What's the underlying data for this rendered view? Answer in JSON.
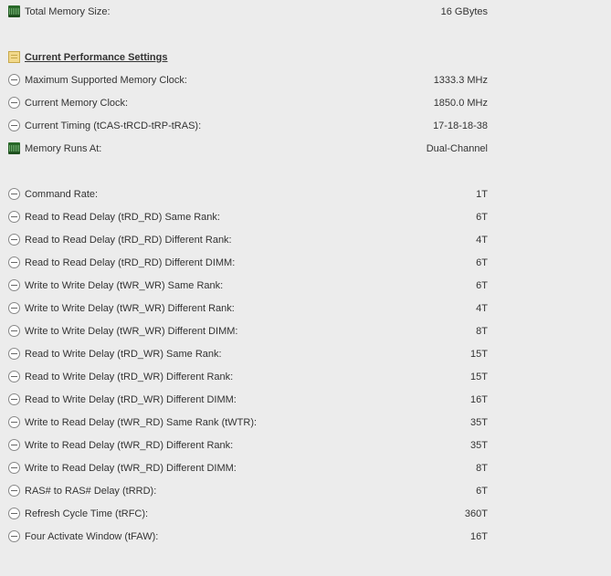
{
  "top": {
    "total_memory_label": "Total Memory Size:",
    "total_memory_value": "16 GBytes"
  },
  "section_title": "Current Performance Settings",
  "perf": [
    {
      "label": "Maximum Supported Memory Clock:",
      "value": "1333.3 MHz"
    },
    {
      "label": "Current Memory Clock:",
      "value": "1850.0 MHz"
    },
    {
      "label": "Current Timing (tCAS-tRCD-tRP-tRAS):",
      "value": "17-18-18-38"
    }
  ],
  "runs_at": {
    "label": "Memory Runs At:",
    "value": "Dual-Channel"
  },
  "timings": [
    {
      "label": "Command Rate:",
      "value": "1T"
    },
    {
      "label": "Read to Read Delay (tRD_RD) Same Rank:",
      "value": "6T"
    },
    {
      "label": "Read to Read Delay (tRD_RD) Different Rank:",
      "value": "4T"
    },
    {
      "label": "Read to Read Delay (tRD_RD) Different DIMM:",
      "value": "6T"
    },
    {
      "label": "Write to Write Delay (tWR_WR) Same Rank:",
      "value": "6T"
    },
    {
      "label": "Write to Write Delay (tWR_WR) Different Rank:",
      "value": "4T"
    },
    {
      "label": "Write to Write Delay (tWR_WR) Different DIMM:",
      "value": "8T"
    },
    {
      "label": "Read to Write Delay (tRD_WR) Same Rank:",
      "value": "15T"
    },
    {
      "label": "Read to Write Delay (tRD_WR) Different Rank:",
      "value": "15T"
    },
    {
      "label": "Read to Write Delay (tRD_WR) Different DIMM:",
      "value": "16T"
    },
    {
      "label": "Write to Read Delay (tWR_RD) Same Rank (tWTR):",
      "value": "35T"
    },
    {
      "label": "Write to Read Delay (tWR_RD) Different Rank:",
      "value": "35T"
    },
    {
      "label": "Write to Read Delay (tWR_RD) Different DIMM:",
      "value": "8T"
    },
    {
      "label": "RAS# to RAS# Delay (tRRD):",
      "value": "6T"
    },
    {
      "label": "Refresh Cycle Time (tRFC):",
      "value": "360T"
    },
    {
      "label": "Four Activate Window (tFAW):",
      "value": "16T"
    }
  ]
}
